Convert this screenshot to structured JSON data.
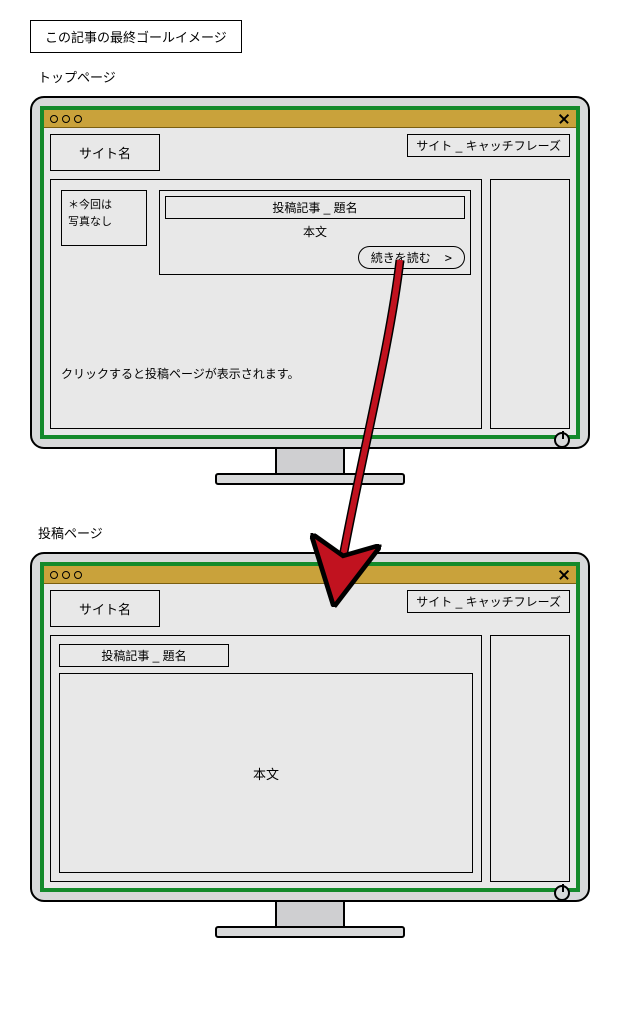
{
  "goal_label": "この記事の最終ゴールイメージ",
  "sections": {
    "top_page_label": "トップページ",
    "post_page_label": "投稿ページ"
  },
  "site": {
    "name": "サイト名",
    "catch_phrase": "サイト _ キャッチフレーズ"
  },
  "top_page": {
    "thumbnail_note_line1": "＊今回は",
    "thumbnail_note_line2": "写真なし",
    "post_title": "投稿記事 _ 題名",
    "post_body_label": "本文",
    "read_more_label": "続きを読む",
    "read_more_arrow": ">",
    "click_note": "クリックすると投稿ページが表示されます。"
  },
  "post_page": {
    "post_title": "投稿記事 _ 題名",
    "body_label": "本文"
  },
  "colors": {
    "frame_green": "#148a2b",
    "titlebar_gold": "#c9a23b",
    "bezel_gray": "#d8d9da",
    "arrow_red": "#c1121f"
  }
}
